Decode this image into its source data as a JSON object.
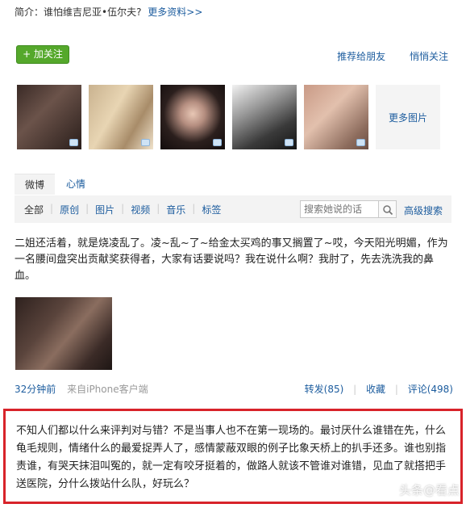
{
  "profile": {
    "intro_label": "简介：谁怕维吉尼亚•伍尔夫?",
    "more_info_link": "更多资料>>"
  },
  "actions": {
    "follow_button": "+ 加关注",
    "recommend_link": "推荐给朋友",
    "quiet_follow_link": "悄悄关注"
  },
  "photos": {
    "more_label": "更多图片"
  },
  "tabs": [
    {
      "label": "微博"
    },
    {
      "label": "心情"
    }
  ],
  "filters": [
    "全部",
    "原创",
    "图片",
    "视频",
    "音乐",
    "标签"
  ],
  "search": {
    "placeholder": "搜索她说的话",
    "advanced_label": "高级搜索"
  },
  "post": {
    "text": "二姐还活着，就是烧凌乱了。凌~乱~了~给金太买鸡的事又搁置了~哎，今天阳光明媚，作为一名腰间盘突出贡献奖获得者，大家有话要说吗？我在说什么啊？我肘了，先去洗洗我的鼻血。",
    "time": "32分钟前",
    "source": "来自iPhone客户端",
    "repost": "转发(85)",
    "favorite": "收藏",
    "comment": "评论(498)"
  },
  "comment_box": {
    "text": "不知人们都以什么来评判对与错？不是当事人也不在第一现场的。最讨厌什么谁错在先，什么龟毛规则，情绪什么的最爱捉弄人了，感情蒙蔽双眼的例子比象天桥上的扒手还多。谁也别指责谁，有哭天抹泪叫冤的，就一定有咬牙挺着的，做路人就该不管谁对谁错，见血了就搭把手送医院，分什么拨站什么队，好玩么？"
  },
  "watermark": "头条@看点"
}
